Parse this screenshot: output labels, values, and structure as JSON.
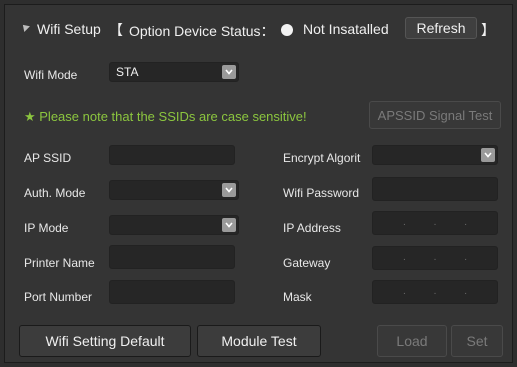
{
  "header": {
    "title": "Wifi Setup",
    "bracket_open": "【",
    "status_label": "Option Device Status：",
    "status_value": "Not Insatalled",
    "refresh_label": "Refresh",
    "bracket_close": "】"
  },
  "wifi_mode": {
    "label": "Wifi Mode",
    "value": "STA"
  },
  "note": "★ Please note that the SSIDs are case sensitive!",
  "apssid_button": "APSSID Signal Test",
  "left_fields": {
    "ap_ssid": "AP SSID",
    "auth_mode": "Auth. Mode",
    "ip_mode": "IP Mode",
    "printer_name": "Printer Name",
    "port_number": "Port Number"
  },
  "right_fields": {
    "encrypt": "Encrypt Algorit",
    "wifi_password": "Wifi Password",
    "ip_address": "IP Address",
    "gateway": "Gateway",
    "mask": "Mask"
  },
  "ip_dot": ".",
  "buttons": {
    "default": "Wifi Setting Default",
    "module_test": "Module Test",
    "load": "Load",
    "set": "Set"
  },
  "colors": {
    "note": "#8cc63f",
    "panel": "#343434",
    "field": "#262626"
  },
  "icons": {
    "collapse": "triangle-icon",
    "status": "status-dot-icon",
    "dropdown": "chevron-down-icon"
  }
}
